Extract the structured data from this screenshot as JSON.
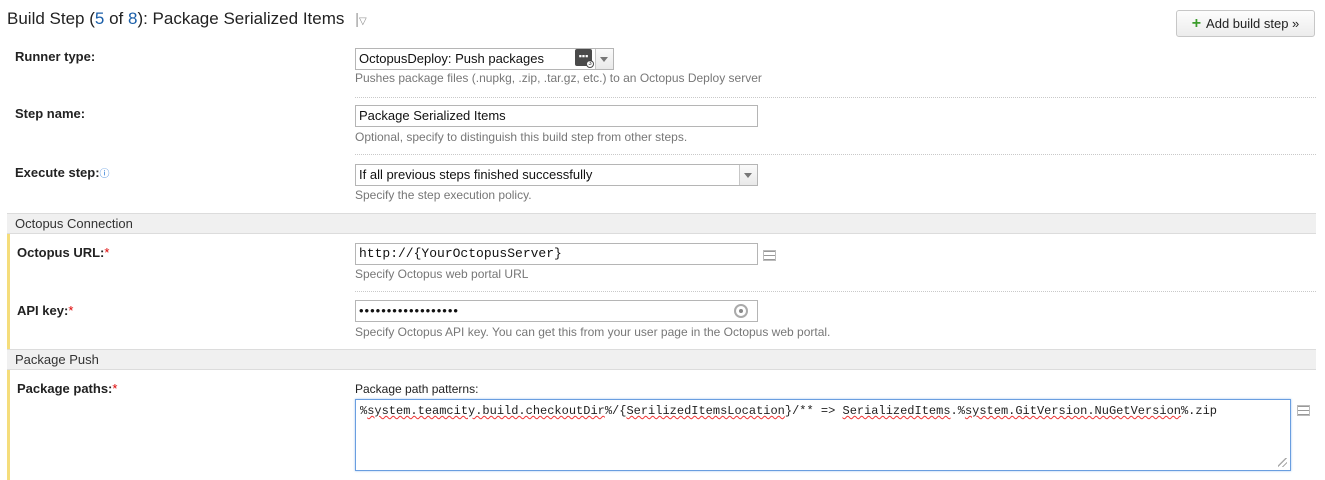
{
  "header": {
    "title_prefix": "Build Step (",
    "step_current": "5",
    "step_of": " of ",
    "step_total": "8",
    "title_suffix": "): Package Serialized Items",
    "menu_glyph": "|",
    "menu_arrow": "▽"
  },
  "toolbar": {
    "add_build_step_label": "Add build step »",
    "add_icon": "plus-icon"
  },
  "runner": {
    "label": "Runner type:",
    "value": "OctopusDeploy: Push packages",
    "note": "Pushes package files (.nupkg, .zip, .tar.gz, etc.) to an Octopus Deploy server"
  },
  "step_name": {
    "label": "Step name:",
    "value": "Package Serialized Items",
    "note": "Optional, specify to distinguish this build step from other steps."
  },
  "execute_step": {
    "label": "Execute step:",
    "value": "If all previous steps finished successfully",
    "note": "Specify the step execution policy."
  },
  "sections": {
    "octopus_connection": "Octopus Connection",
    "package_push": "Package Push"
  },
  "octopus_url": {
    "label": "Octopus URL:",
    "required": "*",
    "value": "http://{YourOctopusServer}",
    "note": "Specify Octopus web portal URL"
  },
  "api_key": {
    "label": "API key:",
    "required": "*",
    "value": "••••••••••••••••••",
    "note": "Specify Octopus API key. You can get this from your user page in the Octopus web portal."
  },
  "package_paths": {
    "label": "Package paths:",
    "required": "*",
    "sublabel": "Package path patterns:",
    "value_parts": [
      "%",
      "system.teamcity.build.checkoutDir",
      "%/{",
      "SerilizedItemsLocation",
      "}/** => ",
      "SerializedItems",
      ".%",
      "system.GitVersion.NuGetVersion",
      "%.zip"
    ]
  },
  "colors": {
    "link": "#1a5ea8",
    "required_bar": "#f5dd7b",
    "required_star": "#dd0000",
    "focus_border": "#6a9ee0"
  }
}
